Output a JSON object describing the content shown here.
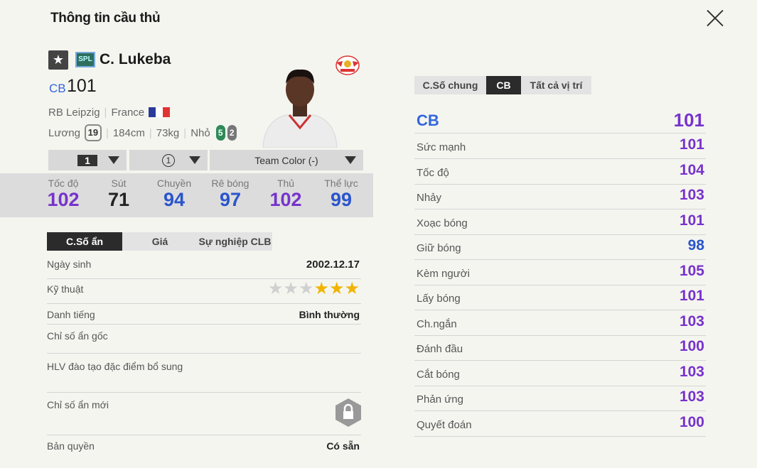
{
  "header": {
    "title": "Thông tin cầu thủ"
  },
  "player": {
    "season_badge": "SPL",
    "name": "C. Lukeba",
    "position": "CB",
    "overall": "101",
    "club": "RB Leipzig",
    "nation": "France",
    "salary_label": "Lương",
    "salary": "19",
    "height": "184cm",
    "weight": "73kg",
    "body_type": "Nhỏ",
    "weak_foot_left": "5",
    "weak_foot_right": "2"
  },
  "selectors": {
    "level": "1",
    "grade": "1",
    "team_color": "Team Color (-)"
  },
  "summary_stats": [
    {
      "label": "Tốc độ",
      "value": "102",
      "color": "#7733cc"
    },
    {
      "label": "Sút",
      "value": "71",
      "color": "#222222"
    },
    {
      "label": "Chuyền",
      "value": "94",
      "color": "#2a55cc"
    },
    {
      "label": "Rê bóng",
      "value": "97",
      "color": "#2a55cc"
    },
    {
      "label": "Thủ",
      "value": "102",
      "color": "#7733cc"
    },
    {
      "label": "Thể lực",
      "value": "99",
      "color": "#2a55cc"
    }
  ],
  "left_tabs": [
    "C.Số ẩn",
    "Giá",
    "Sự nghiệp CLB"
  ],
  "info": {
    "birth_label": "Ngày sinh",
    "birth": "2002.12.17",
    "skill_label": "Kỹ thuật",
    "skill_stars": 3,
    "reputation_label": "Danh tiếng",
    "reputation": "Bình thường",
    "hidden_orig_label": "Chỉ số ẩn gốc",
    "coach_label": "HLV đào tạo đặc điểm bổ sung",
    "hidden_new_label": "Chỉ số ẩn mới",
    "copyright_label": "Bản quyền",
    "copyright": "Có sẵn"
  },
  "right_tabs": [
    "C.Số chung",
    "CB",
    "Tất cả vị trí"
  ],
  "position_ovr": {
    "label": "CB",
    "value": "101"
  },
  "attributes": [
    {
      "label": "Sức mạnh",
      "value": "101",
      "color": "#7733cc"
    },
    {
      "label": "Tốc độ",
      "value": "104",
      "color": "#7733cc"
    },
    {
      "label": "Nhảy",
      "value": "103",
      "color": "#7733cc"
    },
    {
      "label": "Xoạc bóng",
      "value": "101",
      "color": "#7733cc"
    },
    {
      "label": "Giữ bóng",
      "value": "98",
      "color": "#2a55cc"
    },
    {
      "label": "Kèm người",
      "value": "105",
      "color": "#7733cc"
    },
    {
      "label": "Lấy bóng",
      "value": "101",
      "color": "#7733cc"
    },
    {
      "label": "Ch.ngắn",
      "value": "103",
      "color": "#7733cc"
    },
    {
      "label": "Đánh đầu",
      "value": "100",
      "color": "#7733cc"
    },
    {
      "label": "Cắt bóng",
      "value": "103",
      "color": "#7733cc"
    },
    {
      "label": "Phản ứng",
      "value": "103",
      "color": "#7733cc"
    },
    {
      "label": "Quyết đoán",
      "value": "100",
      "color": "#7733cc"
    }
  ]
}
